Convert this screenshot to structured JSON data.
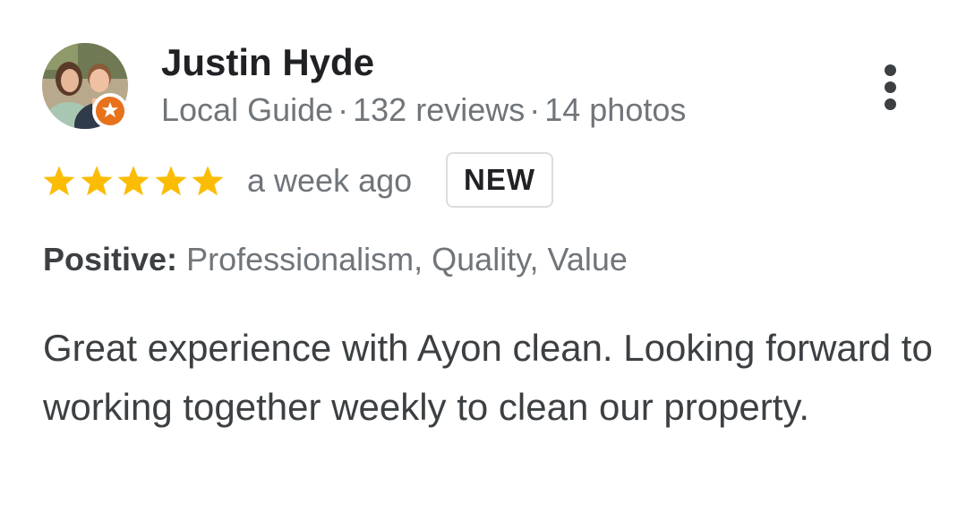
{
  "reviewer": {
    "name": "Justin Hyde",
    "badge": "Local Guide",
    "reviews": "132 reviews",
    "photos": "14 photos",
    "separator": "·",
    "avatar_icon": "profile-photo",
    "badge_icon": "local-guide-star-icon"
  },
  "review": {
    "rating": 5,
    "rating_max": 5,
    "time": "a week ago",
    "new_label": "NEW",
    "attributes_label": "Positive:",
    "attributes_values": "Professionalism, Quality, Value",
    "text": "Great experience with Ayon clean. Looking forward to working together weekly to clean our property."
  },
  "actions": {
    "more_icon": "more-vert-icon"
  },
  "colors": {
    "star": "#fbbc04",
    "secondary_text": "#70757a",
    "primary_text": "#202124",
    "guide_badge": "#e8711c",
    "badge_border": "#dadce0"
  }
}
